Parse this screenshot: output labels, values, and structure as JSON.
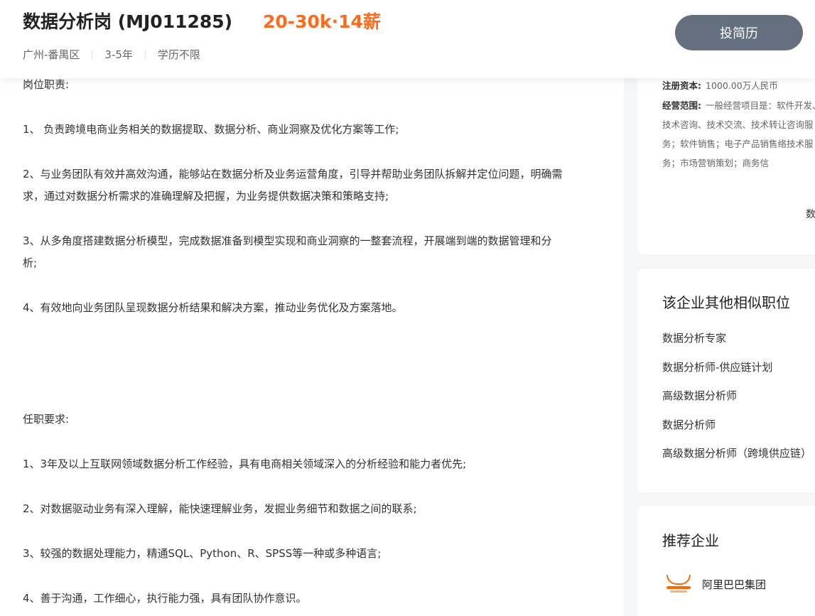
{
  "header": {
    "job_title": "数据分析岗 (MJ011285)",
    "salary": "20-30k·14薪",
    "location": "广州-番禺区",
    "experience": "3-5年",
    "education": "学历不限",
    "apply_label": "投简历"
  },
  "description": {
    "lines": [
      "岗位职责:",
      "1、 负责跨境电商业务相关的数据提取、数据分析、商业洞察及优化方案等工作;",
      "2、与业务团队有效并高效沟通，能够站在数据分析及业务运营角度，引导并帮助业务团队拆解并定位问题，明确需",
      "求，通过对数据分析需求的准确理解及把握，为业务提供数据决策和策略支持;",
      "3、从多角度搭建数据分析模型，完成数据准备到模型实现和商业洞察的一整套流程，开展端到端的数据管理和分",
      "析;",
      "4、有效地向业务团队呈现数据分析结果和解决方案，推动业务优化及方案落地。",
      "任职要求:",
      "1、3年及以上互联网领域数据分析工作经验，具有电商相关领域深入的分析经验和能力者优先;",
      "2、对数据驱动业务有深入理解，能快速理解业务，发掘业务细节和数据之间的联系;",
      "3、较强的数据处理能力，精通SQL、Python、R、SPSS等一种或多种语言;",
      "4、善于沟通，工作细心，执行能力强，具有团队协作意识。"
    ]
  },
  "company_info": {
    "capital_label": "注册资本:",
    "capital_value": "1000.00万人民币",
    "scope_label": "经营范围:",
    "scope_value": "一般经营项目是：软件开发、技术咨询、技术交流、技术转让咨询服务；软件销售；电子产品销售络技术服务；市场营销策划；商务信",
    "clipped_text": "数"
  },
  "similar_jobs": {
    "title": "该企业其他相似职位",
    "items": [
      "数据分析专家",
      "数据分析师-供应链计划",
      "高级数据分析师",
      "数据分析师",
      "高级数据分析师（跨境供应链）"
    ]
  },
  "recommend": {
    "title": "推荐企业",
    "company_name": "阿里巴巴集团",
    "logo_icon": "alibaba-logo-icon",
    "brand_color": "#ff6a00"
  },
  "colors": {
    "salary": "#fe6b1e",
    "apply_button": "#646f80"
  }
}
